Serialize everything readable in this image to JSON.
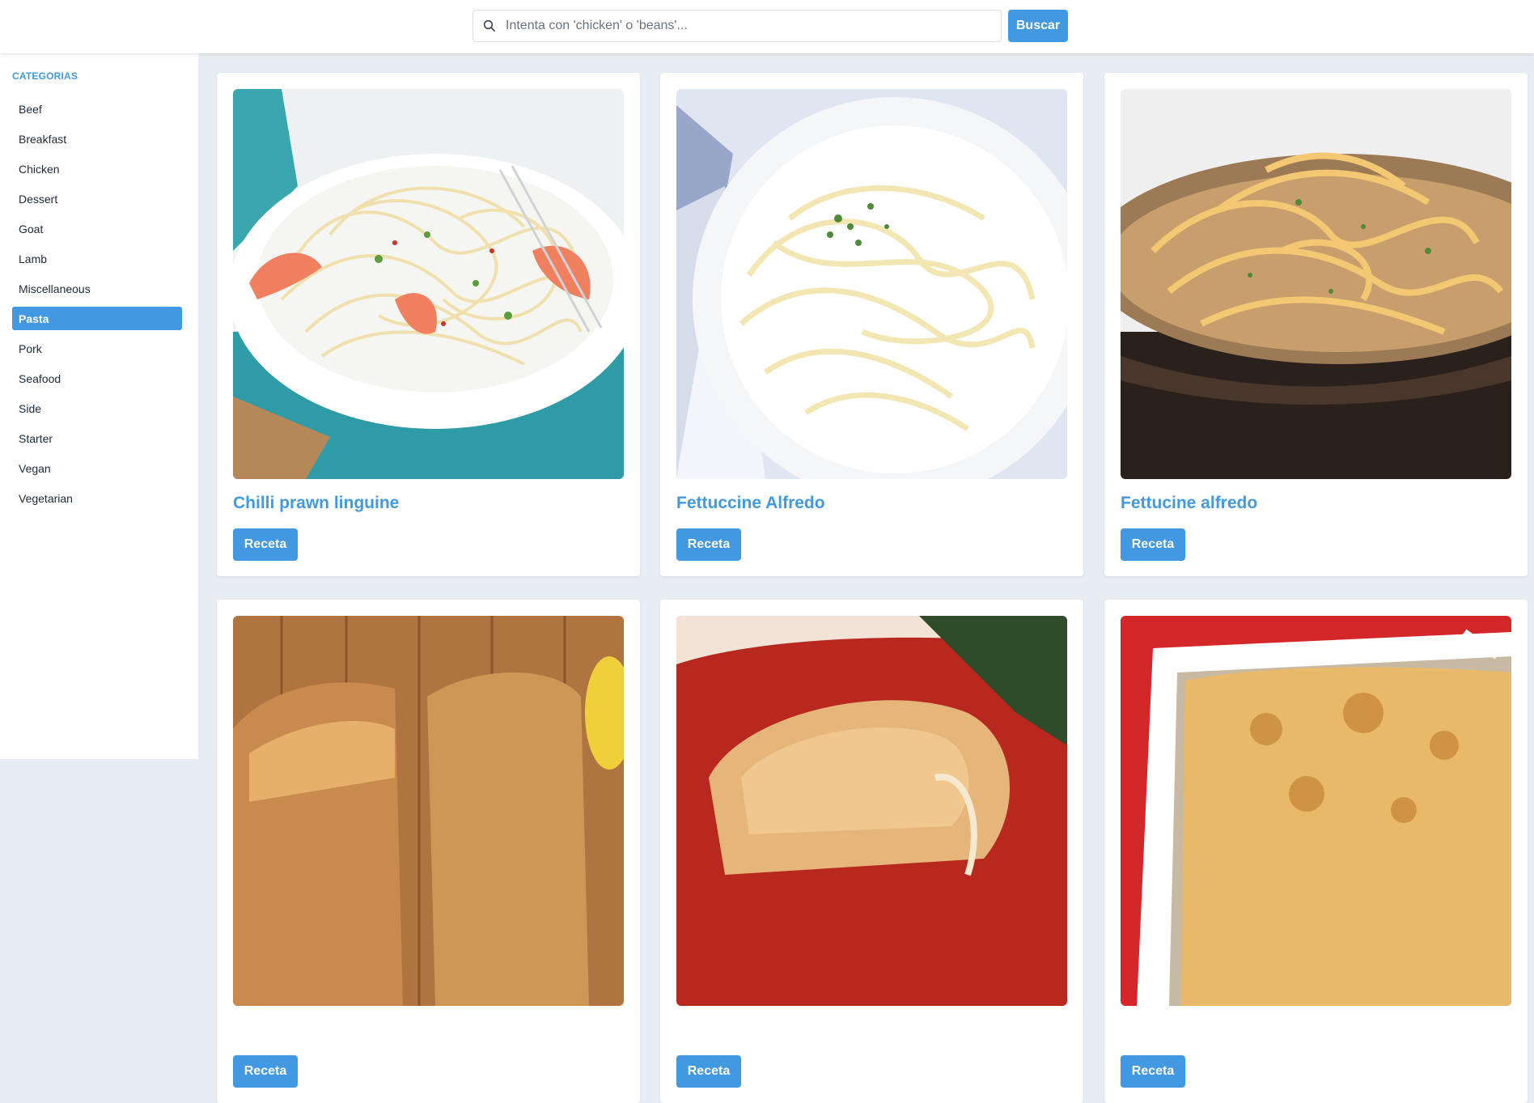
{
  "search": {
    "placeholder": "Intenta con 'chicken' o 'beans'...",
    "value": "",
    "button_label": "Buscar"
  },
  "sidebar": {
    "title": "CATEGORIAS",
    "active": "Pasta",
    "items": [
      {
        "label": "Beef"
      },
      {
        "label": "Breakfast"
      },
      {
        "label": "Chicken"
      },
      {
        "label": "Dessert"
      },
      {
        "label": "Goat"
      },
      {
        "label": "Lamb"
      },
      {
        "label": "Miscellaneous"
      },
      {
        "label": "Pasta"
      },
      {
        "label": "Pork"
      },
      {
        "label": "Seafood"
      },
      {
        "label": "Side"
      },
      {
        "label": "Starter"
      },
      {
        "label": "Vegan"
      },
      {
        "label": "Vegetarian"
      }
    ]
  },
  "recipes": [
    {
      "title": "Chilli prawn linguine",
      "button_label": "Receta",
      "image": "pasta-with-prawns-photo"
    },
    {
      "title": "Fettuccine Alfredo",
      "button_label": "Receta",
      "image": "fettuccine-white-plate-photo"
    },
    {
      "title": "Fettucine alfredo",
      "button_label": "Receta",
      "image": "fettucine-bowl-photo"
    },
    {
      "title": "",
      "button_label": "Receta",
      "image": "grilled-cheese-photo"
    },
    {
      "title": "",
      "button_label": "Receta",
      "image": "toasted-sandwich-photo"
    },
    {
      "title": "",
      "button_label": "Receta",
      "image": "baked-lasagna-photo"
    }
  ],
  "colors": {
    "accent": "#4299e1",
    "background": "#e8edf3"
  }
}
